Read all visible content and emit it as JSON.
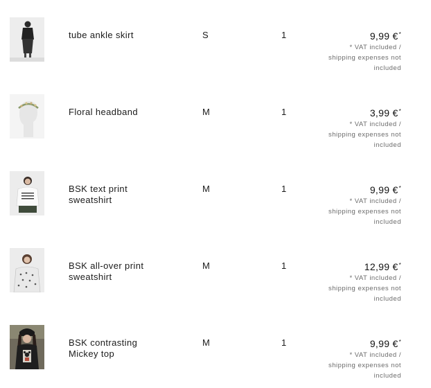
{
  "cart": {
    "items": [
      {
        "name": "tube ankle skirt",
        "size": "S",
        "quantity": "1",
        "price": "9,99 €",
        "price_mark": "*",
        "note_1": "* VAT included /",
        "note_2": "shipping expenses not",
        "note_3": "included",
        "image_icon": "skirt-photo-icon"
      },
      {
        "name": "Floral headband",
        "size": "M",
        "quantity": "1",
        "price": "3,99 €",
        "price_mark": "*",
        "note_1": "* VAT included /",
        "note_2": "shipping expenses not",
        "note_3": "included",
        "image_icon": "headband-photo-icon"
      },
      {
        "name": "BSK text print sweatshirt",
        "size": "M",
        "quantity": "1",
        "price": "9,99 €",
        "price_mark": "*",
        "note_1": "* VAT included /",
        "note_2": "shipping expenses not",
        "note_3": "included",
        "image_icon": "sweatshirt-photo-icon"
      },
      {
        "name": "BSK all-over print sweatshirt",
        "size": "M",
        "quantity": "1",
        "price": "12,99 €",
        "price_mark": "*",
        "note_1": "* VAT included /",
        "note_2": "shipping expenses not",
        "note_3": "included",
        "image_icon": "print-sweatshirt-photo-icon"
      },
      {
        "name": "BSK contrasting Mickey top",
        "size": "M",
        "quantity": "1",
        "price": "9,99 €",
        "price_mark": "*",
        "note_1": "* VAT included /",
        "note_2": "shipping expenses not",
        "note_3": "included",
        "image_icon": "mickey-top-photo-icon"
      }
    ]
  }
}
